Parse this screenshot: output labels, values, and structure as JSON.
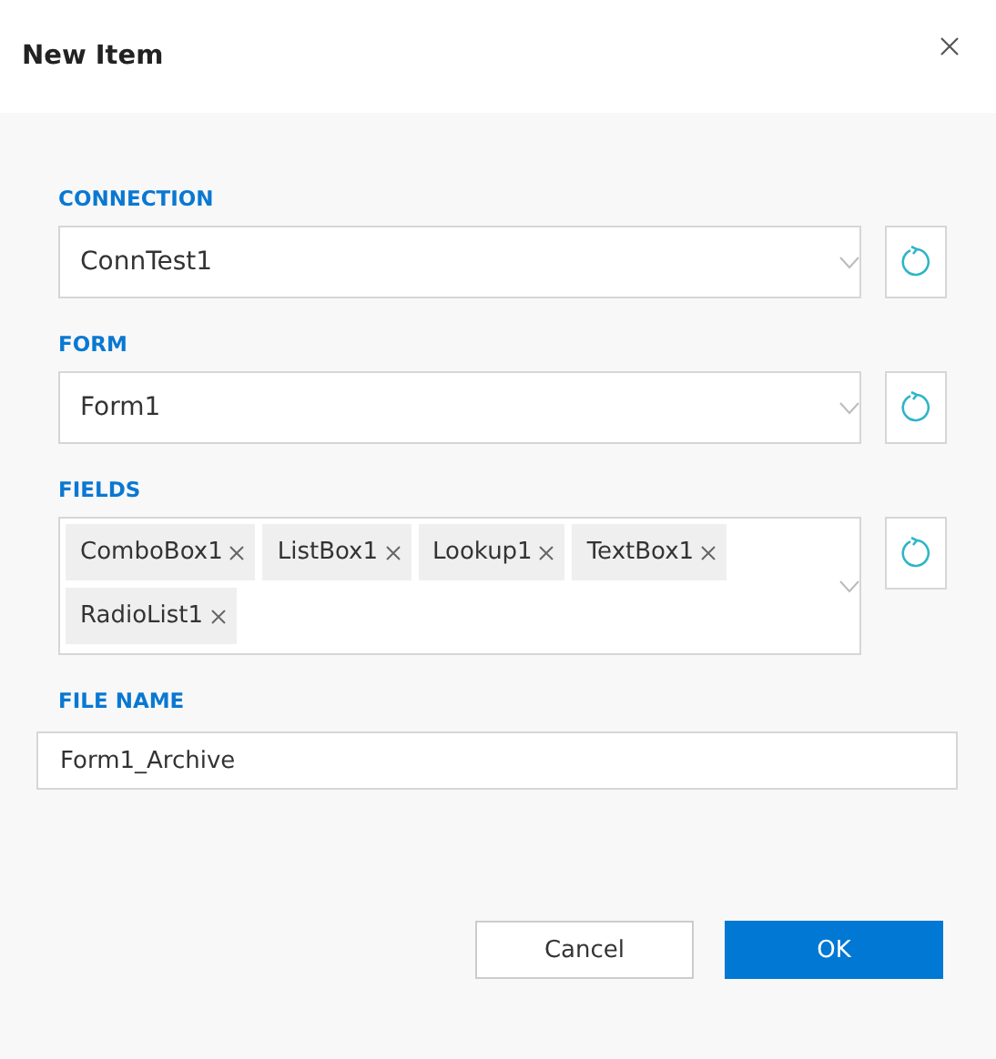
{
  "dialog": {
    "title": "New Item"
  },
  "connection": {
    "label": "CONNECTION",
    "value": "ConnTest1"
  },
  "form": {
    "label": "FORM",
    "value": "Form1"
  },
  "fields": {
    "label": "FIELDS",
    "tags": [
      "ComboBox1",
      "ListBox1",
      "Lookup1",
      "TextBox1",
      "RadioList1"
    ]
  },
  "file_name": {
    "label": "FILE NAME",
    "value": "Form1_Archive"
  },
  "buttons": [
    {
      "label": "Cancel",
      "kind": "secondary"
    },
    {
      "label": "OK",
      "kind": "primary"
    }
  ]
}
